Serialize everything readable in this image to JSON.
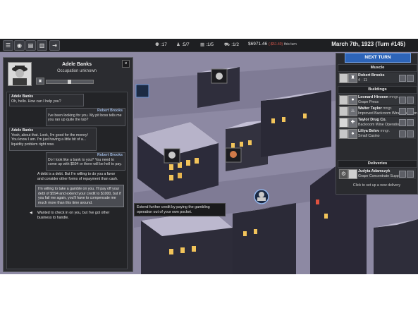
{
  "topbar": {
    "stats": [
      {
        "icon": "thug-icon",
        "value": "17"
      },
      {
        "icon": "crew-icon",
        "value": "5/7"
      },
      {
        "icon": "building-icon",
        "value": "1/5"
      },
      {
        "icon": "truck-icon",
        "value": "1/2"
      },
      {
        "icon": "money-icon",
        "value": "$6971.46",
        "delta": "(-$51.40)",
        "delta_label": "this turn"
      }
    ],
    "date": "March 7th, 1923  (Turn #145)"
  },
  "next_turn": "NEXT TURN",
  "dialog": {
    "name": "Adele Banks",
    "occupation": "Occupation unknown",
    "close": "×",
    "messages": [
      {
        "speaker": "Adele Banks",
        "text": "Oh, hello. How can I help you?"
      },
      {
        "speaker": "Robert Brooks",
        "text": "I've been looking for you. My pit boss tells me you ran up quite the tab?"
      },
      {
        "speaker": "Adele Banks",
        "text": "Yeah, about that. Look, I'm good for the money! You know I am. I'm just having a little bit of a... liquidity problem right now."
      },
      {
        "speaker": "Robert Brooks",
        "text": "Do I look like a bank to you? You need to come up with $594 or there will be hell to pay."
      }
    ],
    "choices": [
      "A debt is a debt. But I'm willing to do you a favor and consider other forms of repayment than cash.",
      "I'm willing to take a gamble on you. I'll pay off your debt of $594 and extend your credit to $1000, but if you fail me again, you'll have to compensate me much more than this time around.",
      "Wanted to check in on you, but I've got other business to handle."
    ],
    "tooltip": "Extend further credit by paying the gambling operation out of your own pocket."
  },
  "right_panel": {
    "muscle_title": "Muscle",
    "muscle": [
      {
        "name": "Robert Brooks",
        "sub": "4 · 11"
      }
    ],
    "buildings_title": "Buildings",
    "buildings": [
      {
        "name": "Leonard Hiroeen",
        "role": "mngr.",
        "sub": "Grape Press"
      },
      {
        "name": "Walter Taylor",
        "role": "mngr.",
        "sub": "Improved Backroom Wine Operation"
      },
      {
        "name": "Taylor Drug Co.",
        "role": "",
        "sub": "Backroom Wine Operation"
      },
      {
        "name": "Liliya Belov",
        "role": "mngr.",
        "sub": "Small Casino"
      }
    ],
    "deliveries_title": "Deliveries",
    "deliveries": [
      {
        "name": "Judyta Adamczyk",
        "sub": "Grape Concentrate Supply"
      }
    ],
    "hint": "Click to set up a new delivery"
  }
}
